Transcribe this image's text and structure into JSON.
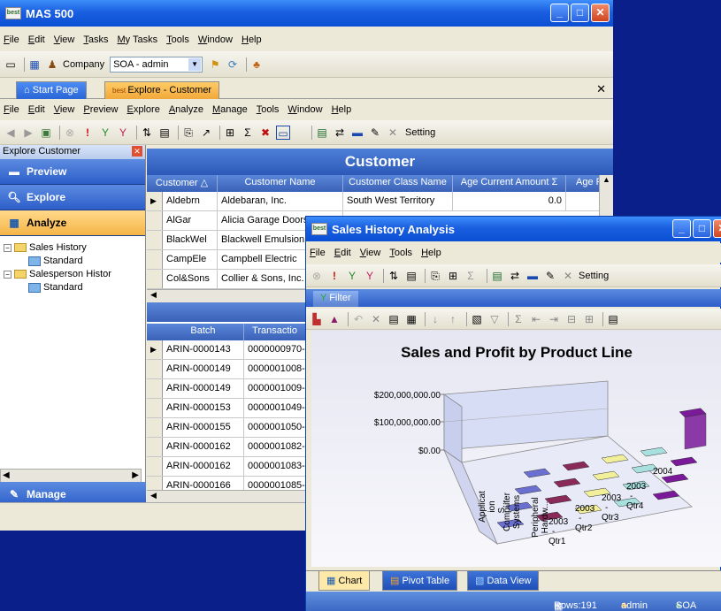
{
  "main_window": {
    "title": "MAS 500",
    "menu": [
      "File",
      "Edit",
      "View",
      "Tasks",
      "My Tasks",
      "Tools",
      "Window",
      "Help"
    ],
    "company_label": "Company",
    "company_value": "SOA - admin"
  },
  "tabs": [
    {
      "label": "Start Page"
    },
    {
      "label": "Explore - Customer"
    }
  ],
  "doc_menu": [
    "File",
    "Edit",
    "View",
    "Preview",
    "Explore",
    "Analyze",
    "Manage",
    "Tools",
    "Window",
    "Help"
  ],
  "doc_toolbar": {
    "setting_label": "Setting"
  },
  "left_pane": {
    "header": "Explore Customer",
    "nav": [
      {
        "label": "Preview"
      },
      {
        "label": "Explore"
      },
      {
        "label": "Analyze"
      }
    ],
    "tree": [
      {
        "label": "Sales History",
        "child": "Standard"
      },
      {
        "label": "Salesperson Histor",
        "child": "Standard"
      }
    ],
    "manage_label": "Manage"
  },
  "customer_grid": {
    "title": "Customer",
    "columns": [
      "Customer",
      "Customer Name",
      "Customer Class Name",
      "Age Current Amount",
      "Age P"
    ],
    "rows": [
      [
        "Aldebrn",
        "Aldebaran, Inc.",
        "South West Territory",
        "0.0"
      ],
      [
        "AlGar",
        "Alicia Garage Doors",
        "",
        ""
      ],
      [
        "BlackWel",
        "Blackwell Emulsion",
        "",
        ""
      ],
      [
        "CampEle",
        "Campbell Electric",
        "",
        ""
      ],
      [
        "Col&Sons",
        "Collier & Sons, Inc.",
        "",
        ""
      ]
    ]
  },
  "batch_grid": {
    "columns": [
      "Batch",
      "Transactio"
    ],
    "rows": [
      [
        "ARIN-0000143",
        "0000000970-"
      ],
      [
        "ARIN-0000149",
        "0000001008-"
      ],
      [
        "ARIN-0000149",
        "0000001009-"
      ],
      [
        "ARIN-0000153",
        "0000001049-"
      ],
      [
        "ARIN-0000155",
        "0000001050-"
      ],
      [
        "ARIN-0000162",
        "0000001082-"
      ],
      [
        "ARIN-0000162",
        "0000001083-"
      ],
      [
        "ARIN-0000166",
        "0000001085-"
      ]
    ]
  },
  "sales_window": {
    "title": "Sales History Analysis",
    "menu": [
      "File",
      "Edit",
      "View",
      "Tools",
      "Help"
    ],
    "setting_label": "Setting",
    "filter_label": "Filter",
    "tabs": [
      "Chart",
      "Pivot Table",
      "Data View"
    ],
    "status": {
      "rows": "Rows:191",
      "user": "admin",
      "company": "SOA"
    }
  },
  "chart_data": {
    "type": "bar",
    "title": "Sales and Profit by Product Line",
    "y_ticks": [
      "$200,000,000.00",
      "$100,000,000.00",
      "$0.00"
    ],
    "ylim": [
      0,
      200000000
    ],
    "categories": [
      "Applicat ion S...",
      "Computer Systems",
      "Peripheral Hardw..."
    ],
    "periods": [
      "2003 - Qtr1",
      "2003 - Qtr2",
      "2003 - Qtr3",
      "2003 - Qtr4",
      "2004"
    ],
    "values": [
      [
        0,
        0,
        0,
        0,
        0
      ],
      [
        0,
        0,
        0,
        0,
        0
      ],
      [
        0,
        0,
        0,
        0,
        0
      ],
      [
        0,
        0,
        0,
        0,
        115000000
      ]
    ],
    "colors": [
      "#6a6fd0",
      "#8a2a5a",
      "#f2ef9a",
      "#a8e0e0",
      "#7a1a9a"
    ]
  }
}
